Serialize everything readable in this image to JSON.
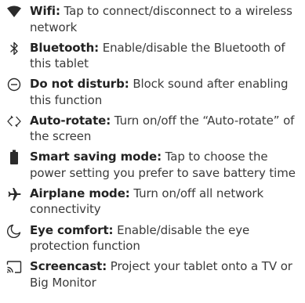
{
  "items": [
    {
      "icon": "wifi-icon",
      "term": "Wifi:",
      "desc": " Tap to connect/disconnect to a wireless network"
    },
    {
      "icon": "bluetooth-icon",
      "term": "Bluetooth:",
      "desc": " Enable/disable the Bluetooth of this tablet"
    },
    {
      "icon": "do-not-disturb-icon",
      "term": "Do not disturb:",
      "desc": " Block sound after enabling this function"
    },
    {
      "icon": "auto-rotate-icon",
      "term": "Auto-rotate:",
      "desc": " Turn on/off the “Auto-rotate” of the screen"
    },
    {
      "icon": "battery-icon",
      "term": "Smart saving mode:",
      "desc": " Tap to choose the power setting you prefer to save battery time"
    },
    {
      "icon": "airplane-icon",
      "term": "Airplane mode:",
      "desc": " Turn on/off all network connectivity"
    },
    {
      "icon": "eye-comfort-icon",
      "term": "Eye comfort:",
      "desc": " Enable/disable the eye protection function"
    },
    {
      "icon": "screencast-icon",
      "term": "Screencast:",
      "desc": " Project your tablet onto a TV or Big Monitor"
    }
  ]
}
